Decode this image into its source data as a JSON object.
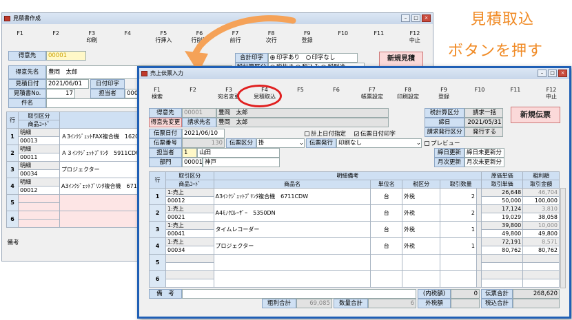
{
  "annotation": {
    "line1": "見積取込",
    "line2": "ボタンを押す",
    "color": "#f08a24"
  },
  "back": {
    "title": "見積書作成",
    "fkeys": [
      {
        "k": "F1",
        "l": ""
      },
      {
        "k": "F2",
        "l": ""
      },
      {
        "k": "F3",
        "l": "印刷"
      },
      {
        "k": "F4",
        "l": ""
      },
      {
        "k": "F5",
        "l": "行挿入"
      },
      {
        "k": "F6",
        "l": "行削除"
      },
      {
        "k": "F7",
        "l": "前行"
      },
      {
        "k": "F8",
        "l": "次行"
      },
      {
        "k": "F9",
        "l": "登録"
      },
      {
        "k": "F10",
        "l": ""
      },
      {
        "k": "F11",
        "l": ""
      },
      {
        "k": "F12",
        "l": "中止"
      }
    ],
    "tokuisaki_label": "得意先",
    "tokuisaki_code": "00001",
    "tokuisaki_name_label": "得意先名",
    "tokuisaki_name": "豊岡　太郎",
    "zei_label": "合計印字",
    "zei_opts": [
      "印字あり",
      "印字なし"
    ],
    "zeisan_label": "税計算区分",
    "zeisan_opts": [
      "税抜き",
      "税込み",
      "税別途"
    ],
    "date_label": "見積日付",
    "date": "2021/06/01",
    "date_print_label": "日付印字",
    "no_label": "見積書No.",
    "no": "17",
    "tanto_label": "担当者",
    "tanto": "0000",
    "kenmei_label": "件名",
    "btn_new": "新規見積",
    "hdr_row": "行",
    "hdr_kubun": "取引区分",
    "hdr_code": "商品ｺｰﾄﾞ",
    "rows": [
      {
        "n": "1",
        "kubun": "明細",
        "name": "Ａ3ｲﾝｸｼﾞｪｯﾄFAX複合機　1620F",
        "code": "00013"
      },
      {
        "n": "2",
        "kubun": "明細",
        "name": "Ａ３ｲﾝｸｼﾞｪｯﾄﾌﾟﾘﾝﾀ　5911CDW",
        "code": "00011"
      },
      {
        "n": "3",
        "kubun": "明細",
        "name": "プロジェクター",
        "code": "00034"
      },
      {
        "n": "4",
        "kubun": "明細",
        "name": "A3ｲﾝｸｼﾞｪｯﾄﾌﾟﾘﾝﾀ複合機　6711",
        "code": "00012"
      },
      {
        "n": "5",
        "kubun": "",
        "name": "",
        "code": ""
      },
      {
        "n": "6",
        "kubun": "",
        "name": "",
        "code": ""
      }
    ],
    "biko_label": "備考"
  },
  "front": {
    "title": "売上伝票入力",
    "fkeys": [
      {
        "k": "F1",
        "l": "検索"
      },
      {
        "k": "F2",
        "l": ""
      },
      {
        "k": "F3",
        "l": "宛名変更"
      },
      {
        "k": "F4",
        "l": "見積取込"
      },
      {
        "k": "F5",
        "l": ""
      },
      {
        "k": "F6",
        "l": ""
      },
      {
        "k": "F7",
        "l": "帳票設定"
      },
      {
        "k": "F8",
        "l": "印刷設定"
      },
      {
        "k": "F9",
        "l": "登録"
      },
      {
        "k": "F10",
        "l": ""
      },
      {
        "k": "F11",
        "l": ""
      },
      {
        "k": "F12",
        "l": "中止"
      }
    ],
    "tokuisaki_label": "得意先",
    "tokuisaki_code": "00001",
    "tokuisaki_name": "豊岡　太郎",
    "seikyu_change": "得意先変更",
    "seikyu_label": "請求先名",
    "seikyu_name": "豊岡　太郎",
    "zeisan_label": "税計算区分",
    "zeisan": "請求一括",
    "shime_label": "締日",
    "shime": "2021/05/31",
    "hakko_label": "請求発行区分",
    "hakko": "発行する",
    "btn_new": "新規伝票",
    "date_label": "伝票日付",
    "date": "2021/06/10",
    "keijo_label": "計上日付指定",
    "dprint_label": "伝票日付印字",
    "no_label": "伝票番号",
    "no": "130",
    "kubun_label": "伝票区分",
    "kubun": "掛",
    "hakko2_label": "伝票発行",
    "hakko2": "印刷なし",
    "preview_label": "プレビュー",
    "tanto_label": "担当者",
    "tanto_code": "1",
    "tanto_name": "山田",
    "bumon_label": "部門",
    "bumon_code": "00001",
    "bumon_name": "神戸",
    "shime_upd_label": "締日更新",
    "shime_upd": "締日未更新分",
    "getsuji_label": "月次更新",
    "getsuji": "月次未更新分",
    "hdr": {
      "row": "行",
      "kubun": "取引区分",
      "code": "商品ｺｰﾄﾞ",
      "meisai": "明細備考",
      "shohin": "商品名",
      "tani": "単位名",
      "zei": "税区分",
      "qty": "取引数量",
      "genka": "原価単価",
      "tanka": "取引単価",
      "arari": "粗利額",
      "kingaku": "取引金額"
    },
    "rows": [
      {
        "n": "1",
        "kubun": "1:売上",
        "code": "00012",
        "name": "A3ｲﾝｸｼﾞｪｯﾄﾌﾟﾘﾝﾀ複合機　6711CDW",
        "tani": "台",
        "zei": "外税",
        "qty": "2",
        "genka": "26,648",
        "tanka": "50,000",
        "arari": "46,704",
        "kingaku": "100,000"
      },
      {
        "n": "2",
        "kubun": "1:売上",
        "code": "00021",
        "name": "A4ﾓﾉｸﾛﾚｰｻﾞｰ　5350DN",
        "tani": "台",
        "zei": "外税",
        "qty": "2",
        "genka": "17,124",
        "tanka": "19,029",
        "arari": "3,810",
        "kingaku": "38,058"
      },
      {
        "n": "3",
        "kubun": "1:売上",
        "code": "00041",
        "name": "タイムレコーダー",
        "tani": "台",
        "zei": "外税",
        "qty": "1",
        "genka": "39,800",
        "tanka": "49,800",
        "arari": "10,000",
        "kingaku": "49,800"
      },
      {
        "n": "4",
        "kubun": "1:売上",
        "code": "00034",
        "name": "プロジェクター",
        "tani": "台",
        "zei": "外税",
        "qty": "1",
        "genka": "72,191",
        "tanka": "80,762",
        "arari": "8,571",
        "kingaku": "80,762"
      },
      {
        "n": "5",
        "kubun": "",
        "code": "",
        "name": "",
        "tani": "",
        "zei": "",
        "qty": "",
        "genka": "",
        "tanka": "",
        "arari": "",
        "kingaku": ""
      },
      {
        "n": "6",
        "kubun": "",
        "code": "",
        "name": "",
        "tani": "",
        "zei": "",
        "qty": "",
        "genka": "",
        "tanka": "",
        "arari": "",
        "kingaku": ""
      }
    ],
    "biko_label": "備　考",
    "uchizei_label": "(内税額)",
    "uchizei": "0",
    "arari_total_label": "粗利合計",
    "arari_total": "69,085",
    "qty_total_label": "数量合計",
    "qty_total": "6",
    "sotozei_label": "外税額",
    "denpyo_total_label": "伝票合計",
    "denpyo_total": "268,620",
    "zeikomi_label": "税込合計"
  }
}
